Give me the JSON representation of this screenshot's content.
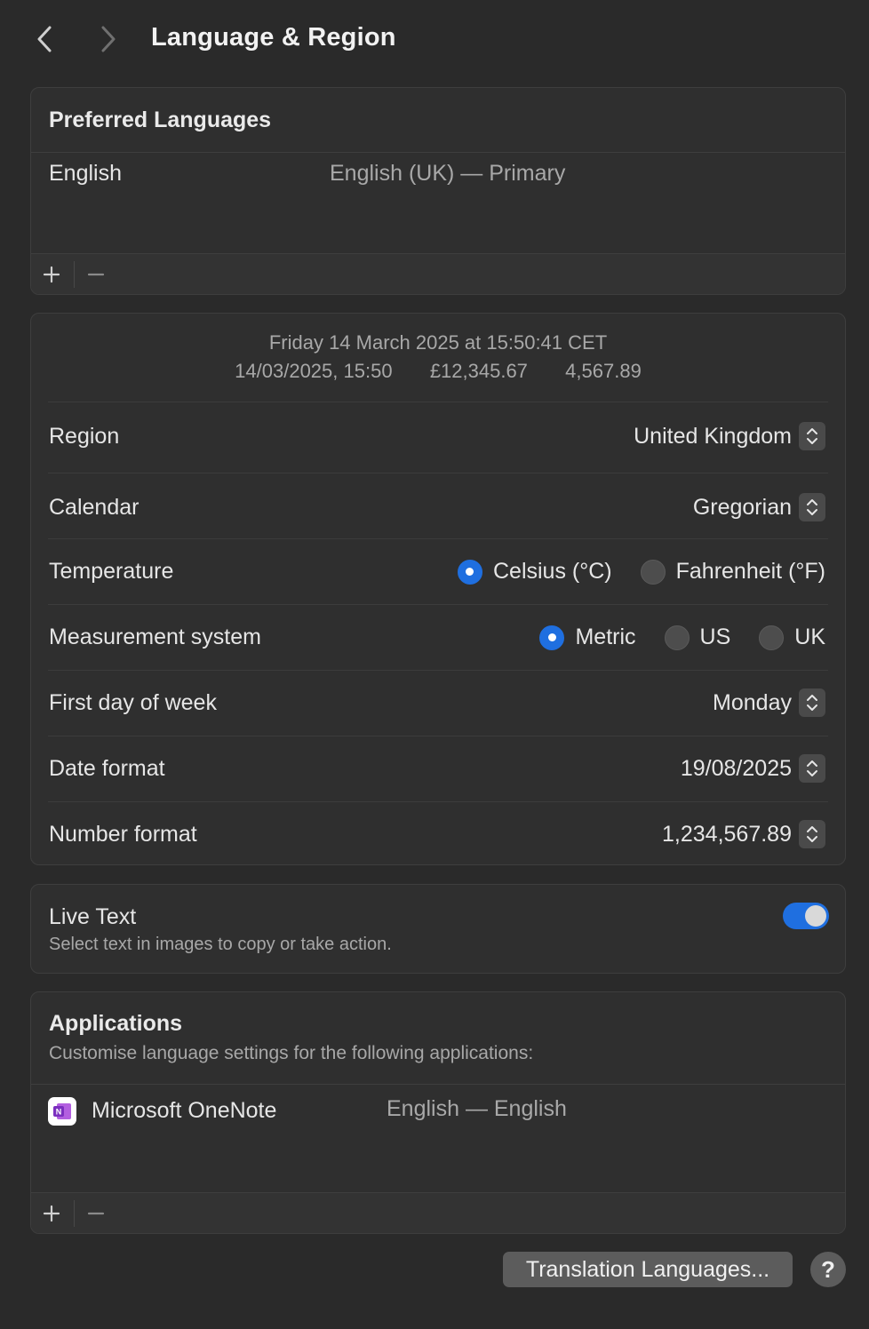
{
  "header": {
    "title": "Language & Region"
  },
  "preferred_languages": {
    "title": "Preferred Languages",
    "items": [
      {
        "name": "English",
        "detail": "English (UK) — Primary"
      }
    ]
  },
  "format_preview": {
    "line1": "Friday 14 March 2025 at 15:50:41 CET",
    "datetime": "14/03/2025, 15:50",
    "currency": "£12,345.67",
    "number": "4,567.89"
  },
  "settings": {
    "region": {
      "label": "Region",
      "value": "United Kingdom"
    },
    "calendar": {
      "label": "Calendar",
      "value": "Gregorian"
    },
    "temperature": {
      "label": "Temperature",
      "options": [
        "Celsius (°C)",
        "Fahrenheit (°F)"
      ],
      "selected": "Celsius (°C)"
    },
    "measurement": {
      "label": "Measurement system",
      "options": [
        "Metric",
        "US",
        "UK"
      ],
      "selected": "Metric"
    },
    "first_day": {
      "label": "First day of week",
      "value": "Monday"
    },
    "date_format": {
      "label": "Date format",
      "value": "19/08/2025"
    },
    "number_format": {
      "label": "Number format",
      "value": "1,234,567.89"
    }
  },
  "live_text": {
    "title": "Live Text",
    "description": "Select text in images to copy or take action.",
    "enabled": true
  },
  "applications": {
    "title": "Applications",
    "description": "Customise language settings for the following applications:",
    "items": [
      {
        "name": "Microsoft OneNote",
        "detail": "English — English",
        "icon": "onenote-icon"
      }
    ]
  },
  "footer": {
    "translation_button": "Translation Languages...",
    "help_button": "?"
  },
  "colors": {
    "accent": "#1f6fe0",
    "background": "#2a2a2a",
    "onenote": "#7b2fbf"
  }
}
